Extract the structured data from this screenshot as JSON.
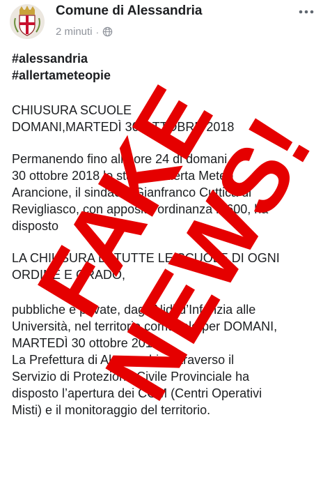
{
  "post": {
    "author": "Comune di Alessandria",
    "time": "2 minuti",
    "separator": "·",
    "icons": {
      "avatar": "coat-of-arms",
      "privacy": "globe-icon",
      "menu": "more-options-icon"
    }
  },
  "content": {
    "hashtags": [
      "#alessandria",
      "#allertameteopie"
    ],
    "title": [
      "CHIUSURA SCUOLE",
      "DOMANI,MARTEDÌ 30 OTTOBRE 2018"
    ],
    "paragraph1": [
      "Permanendo fino alle ore 24 di domani,",
      "30 ottobre 2018 lo stato di Allerta Meteo",
      "Arancione, il sindaco, Gianfranco Cuttica di",
      "Revigliasco, con apposita ordinanza n.600, ha",
      "disposto"
    ],
    "paragraph2": [
      "LA CHIUSURA DI TUTTE LE SCUOLE DI OGNI",
      "ORDINE E GRADO,"
    ],
    "paragraph3": [
      "pubbliche e private, dagli Nidi d’Infanzia alle",
      "Università, nel territorio comunale per DOMANI,",
      "MARTEDÌ 30 ottobre 2018.",
      "La Prefettura di Alessandria attraverso il",
      "Servizio di Protezione Civile Provinciale ha",
      "disposto l’apertura dei COM (Centri Operativi",
      "Misti) e il monitoraggio del territorio."
    ]
  },
  "overlay": {
    "words": [
      "FAKE",
      "NEWS!"
    ],
    "color": "#e50000"
  }
}
